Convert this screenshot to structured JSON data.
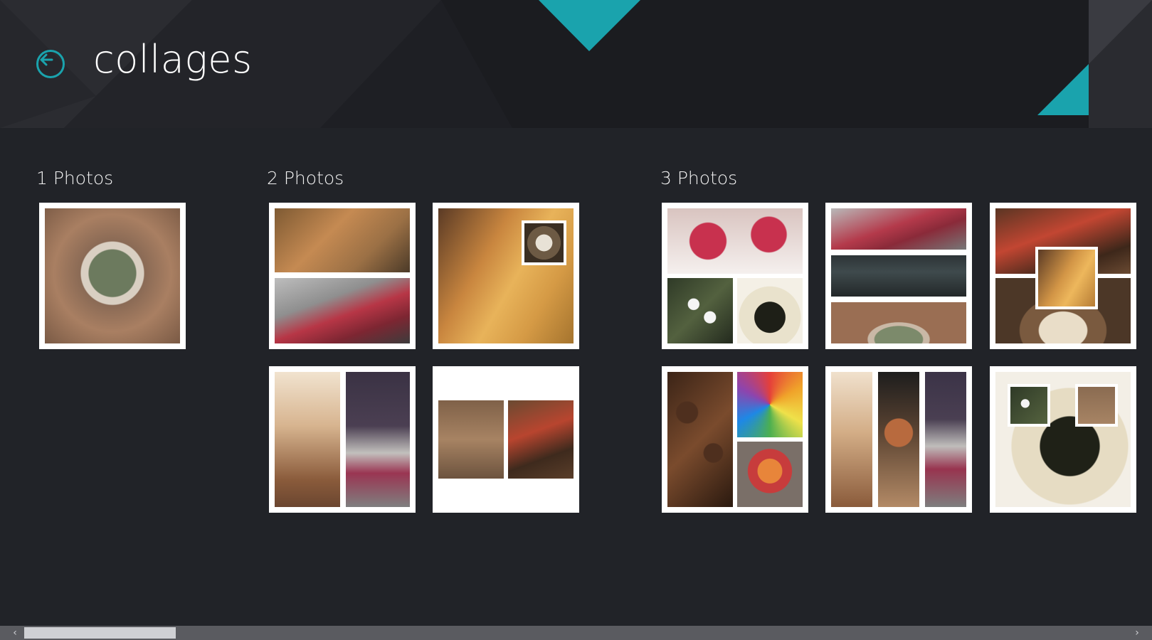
{
  "header": {
    "title": "collages"
  },
  "groups": [
    {
      "title": "1 Photos"
    },
    {
      "title": "2 Photos"
    },
    {
      "title": "3 Photos"
    }
  ],
  "colors": {
    "accent": "#1aa3ad",
    "background": "#212328",
    "header": "#1e1f24"
  },
  "icons": {
    "back": "back-arrow-icon",
    "scroll_left": "chevron-left-icon",
    "scroll_right": "chevron-right-icon"
  },
  "scrollbar": {
    "left_glyph": "‹",
    "right_glyph": "›",
    "position_fraction": 0.0
  }
}
